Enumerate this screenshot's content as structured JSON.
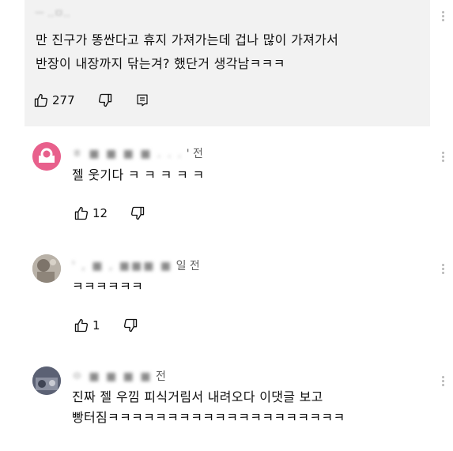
{
  "parent": {
    "author": "ㅡ ..ㅁ..",
    "text_line1": "만 진구가 똥싼다고 휴지 가져가는데 겁나 많이 가져가서",
    "text_line2": "반장이 내장까지 닦는겨? 했단거 생각남ㅋㅋㅋ",
    "likes": "277"
  },
  "replies": [
    {
      "avatar_color": "#e8608c",
      "author_blurred": "ㅎ ■ ■ ■ ■ . . .",
      "time_suffix": "' 전",
      "text": "젤 웃기다 ㅋ ㅋ ㅋ ㅋ ㅋ",
      "likes": "12"
    },
    {
      "avatar_color": "#9a8f84",
      "author_blurred": "' , ■ , ■■■ ■",
      "time_suffix": "일 전",
      "text": "ㅋㅋㅋㅋㅋㅋ",
      "likes": "1"
    },
    {
      "avatar_color": "#6a6f80",
      "author_blurred": "ㅇ ■ ■ ■ ■",
      "time_suffix": "전",
      "text_line1": "진짜 젤 우낌 피식거림서 내려오다 이댓글 보고",
      "text_line2": "빵터짐ㅋㅋㅋㅋㅋㅋㅋㅋㅋㅋㅋㅋㅋㅋㅋㅋㅋㅋㅋㅋ"
    }
  ]
}
